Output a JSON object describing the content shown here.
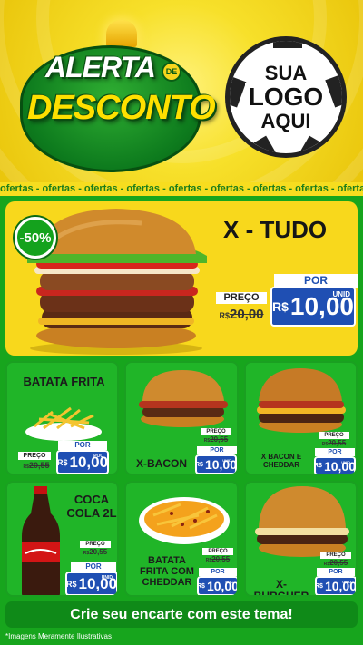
{
  "header": {
    "alert_word": "ALERTA",
    "alert_de": "DE",
    "alert_desc": "DESCONTO",
    "logo_line1": "SUA",
    "logo_line2": "LOGO",
    "logo_line3": "AQUI"
  },
  "strip_text": "ofertas - ofertas - ofertas - ofertas - ofertas - ofertas - ofertas - ofertas - ofertas - ofertas - ofertas",
  "hero": {
    "discount": "-50%",
    "name": "X - TUDO",
    "preco_label": "PREÇO",
    "old_cur": "R$",
    "old_price": "20,00",
    "por_label": "POR",
    "new_cur": "R$",
    "new_price": "10,00",
    "unid": "UNID"
  },
  "products": [
    {
      "name": "BATATA FRITA",
      "preco_label": "PREÇO",
      "old_cur": "R$",
      "old_price": "20,55",
      "por_label": "POR",
      "new_cur": "R$",
      "new_price": "10,00",
      "unid": "POC"
    },
    {
      "name": "X-BACON",
      "preco_label": "PREÇO",
      "old_cur": "R$",
      "old_price": "20,55",
      "por_label": "POR",
      "new_cur": "R$",
      "new_price": "10,00",
      "unid": "UNID"
    },
    {
      "name": "X BACON E CHEDDAR",
      "preco_label": "PREÇO",
      "old_cur": "R$",
      "old_price": "20,55",
      "por_label": "POR",
      "new_cur": "R$",
      "new_price": "10,00",
      "unid": "UNID"
    },
    {
      "name": "COCA COLA 2L",
      "preco_label": "PREÇO",
      "old_cur": "R$",
      "old_price": "20,55",
      "por_label": "POR",
      "new_cur": "R$",
      "new_price": "10,00",
      "unid": "UNID"
    },
    {
      "name": "BATATA FRITA COM CHEDDAR",
      "preco_label": "PREÇO",
      "old_cur": "R$",
      "old_price": "20,55",
      "por_label": "POR",
      "new_cur": "R$",
      "new_price": "10,00",
      "unid": "POC"
    },
    {
      "name": "X-BURGUER",
      "preco_label": "PREÇO",
      "old_cur": "R$",
      "old_price": "20,55",
      "por_label": "POR",
      "new_cur": "R$",
      "new_price": "10,00",
      "unid": "UNID"
    }
  ],
  "footer": {
    "cta": "Crie seu encarte com este tema!",
    "note": "*Imagens Meramente Ilustrativas"
  },
  "colors": {
    "green": "#17a51d",
    "yellow": "#f8d81c",
    "blue": "#1f4fb3"
  }
}
